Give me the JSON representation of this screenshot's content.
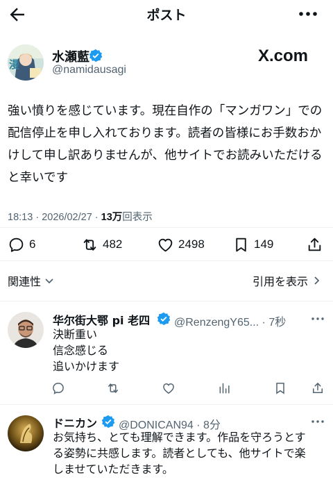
{
  "header": {
    "title": "ポスト"
  },
  "post": {
    "author_name": "水瀬藍",
    "author_handle": "@namidausagi",
    "watermark": "X.com",
    "text": "強い憤りを感じています。現在自作の「マンガワン」での配信停止を申し入れております。読者の皆様にお手数おかけして申し訳ありませんが、他サイトでお読みいただけると幸いです",
    "time": "18:13",
    "date": "2026/02/27",
    "views": "13万",
    "views_label": "回表示",
    "replies": "6",
    "reposts": "482",
    "likes": "2498",
    "bookmarks": "149"
  },
  "relevance_label": "関連性",
  "quotes_label": "引用を表示",
  "replies": [
    {
      "name": "华尔街大鄂 pi 老四",
      "handle": "@RenzengY65...",
      "time": "7秒",
      "lines": [
        "決断重い",
        "信念感じる",
        "追いかけます"
      ]
    },
    {
      "name": "ドニカン",
      "handle": "@DONICAN94",
      "time": "8分",
      "lines": [
        "お気持ち、とても理解できます。作品を守ろうとす",
        "る姿勢に共感します。読者としても、他サイトで楽",
        "しませていただきます。"
      ]
    }
  ],
  "colors": {
    "verified": "#1d9bf0",
    "text": "#0f1419",
    "secondary": "#536471"
  },
  "icons": [
    "back-arrow-icon",
    "more-icon",
    "verified-icon",
    "reply-icon",
    "repost-icon",
    "like-icon",
    "bookmark-icon",
    "share-icon",
    "views-icon",
    "chevron-down-icon",
    "chevron-right-icon"
  ]
}
